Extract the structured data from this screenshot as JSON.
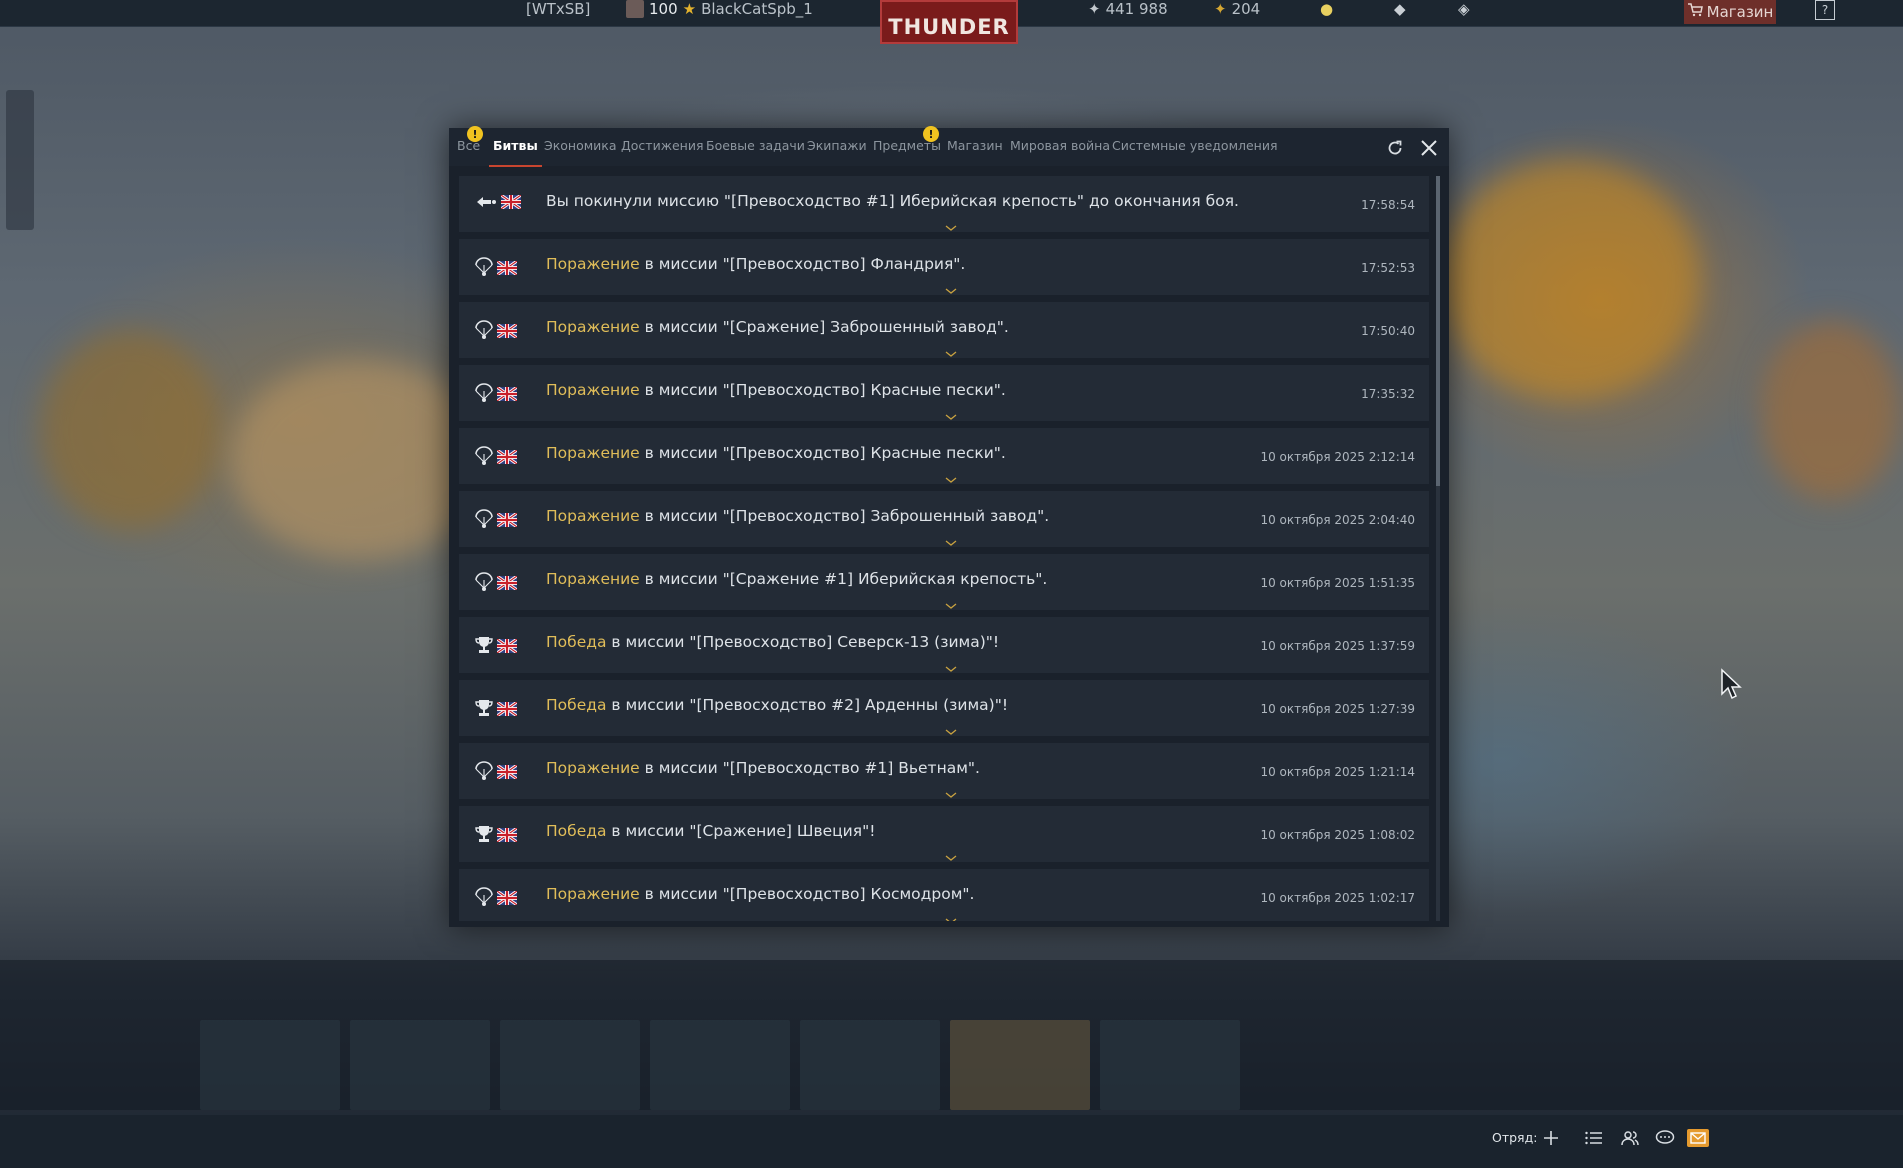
{
  "topbar": {
    "clan_tag": "[WTxSB]",
    "level": "100",
    "nickname": "BlackCatSpb_1",
    "logo": "THUNDER",
    "silver_lions": "441 988",
    "golden_eagles": "204",
    "shop_label": "Магазин",
    "help_label": "?"
  },
  "dialog": {
    "tabs": [
      {
        "label": "Все"
      },
      {
        "label": "Битвы"
      },
      {
        "label": "Экономика"
      },
      {
        "label": "Достижения"
      },
      {
        "label": "Боевые задачи"
      },
      {
        "label": "Экипажи"
      },
      {
        "label": "Предметы"
      },
      {
        "label": "Магазин"
      },
      {
        "label": "Мировая война"
      },
      {
        "label": "Системные уведомления"
      }
    ],
    "alert_mark": "!",
    "messages": [
      {
        "icon": "leave-icon",
        "result": "",
        "text": "Вы покинули миссию \"[Превосходство #1] Иберийская крепость\" до окончания боя.",
        "time": "17:58:54"
      },
      {
        "icon": "parachute-icon",
        "result": "Поражение",
        "text": " в миссии \"[Превосходство] Фландрия\".",
        "time": "17:52:53"
      },
      {
        "icon": "parachute-icon",
        "result": "Поражение",
        "text": " в миссии \"[Сражение] Заброшенный завод\".",
        "time": "17:50:40"
      },
      {
        "icon": "parachute-icon",
        "result": "Поражение",
        "text": " в миссии \"[Превосходство] Красные пески\".",
        "time": "17:35:32"
      },
      {
        "icon": "parachute-icon",
        "result": "Поражение",
        "text": " в миссии \"[Превосходство] Красные пески\".",
        "time": "10 октября 2025 2:12:14"
      },
      {
        "icon": "parachute-icon",
        "result": "Поражение",
        "text": " в миссии \"[Превосходство] Заброшенный завод\".",
        "time": "10 октября 2025 2:04:40"
      },
      {
        "icon": "parachute-icon",
        "result": "Поражение",
        "text": " в миссии \"[Сражение #1] Иберийская крепость\".",
        "time": "10 октября 2025 1:51:35"
      },
      {
        "icon": "trophy-icon",
        "result": "Победа",
        "text": " в миссии \"[Превосходство] Северск-13 (зима)\"!",
        "time": "10 октября 2025 1:37:59"
      },
      {
        "icon": "trophy-icon",
        "result": "Победа",
        "text": " в миссии \"[Превосходство #2] Арденны (зима)\"!",
        "time": "10 октября 2025 1:27:39"
      },
      {
        "icon": "parachute-icon",
        "result": "Поражение",
        "text": " в миссии \"[Превосходство #1] Вьетнам\".",
        "time": "10 октября 2025 1:21:14"
      },
      {
        "icon": "trophy-icon",
        "result": "Победа",
        "text": " в миссии \"[Сражение] Швеция\"!",
        "time": "10 октября 2025 1:08:02"
      },
      {
        "icon": "parachute-icon",
        "result": "Поражение",
        "text": " в миссии \"[Превосходство] Космодром\".",
        "time": "10 октября 2025 1:02:17"
      }
    ]
  },
  "bottom": {
    "squad_label": "Отряд:"
  },
  "colors": {
    "result_highlight": "#e0bd59",
    "active_tab_underline": "#c8452f",
    "alert_badge": "#f0c320"
  }
}
